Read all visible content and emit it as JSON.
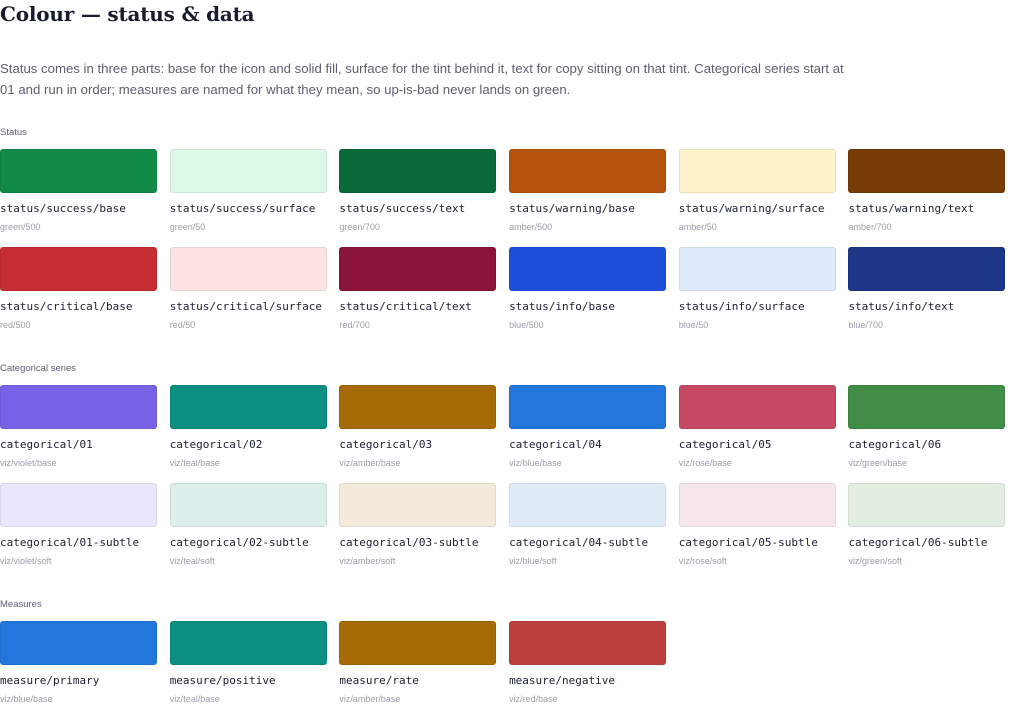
{
  "title": "Colour — status & data",
  "intro": "Status comes in three parts: base for the icon and solid fill, surface for the tint behind it, text for copy sitting on that tint. Categorical series start at 01 and run in order; measures are named for what they mean, so up-is-bad never lands on green.",
  "sections": [
    {
      "label": "Status",
      "rows": [
        [
          {
            "name": "status/success/base",
            "sub": "green/500",
            "color": "#128a48"
          },
          {
            "name": "status/success/surface",
            "sub": "green/50",
            "color": "#dcf8e6"
          },
          {
            "name": "status/success/text",
            "sub": "green/700",
            "color": "#0a6938"
          },
          {
            "name": "status/warning/base",
            "sub": "amber/500",
            "color": "#b5520d"
          },
          {
            "name": "status/warning/surface",
            "sub": "amber/50",
            "color": "#fdf2c9"
          },
          {
            "name": "status/warning/text",
            "sub": "amber/700",
            "color": "#763b06"
          }
        ],
        [
          {
            "name": "status/critical/base",
            "sub": "red/500",
            "color": "#c62e33"
          },
          {
            "name": "status/critical/surface",
            "sub": "red/50",
            "color": "#fde2e2"
          },
          {
            "name": "status/critical/text",
            "sub": "red/700",
            "color": "#8b1337"
          },
          {
            "name": "status/info/base",
            "sub": "blue/500",
            "color": "#1d4fdb"
          },
          {
            "name": "status/info/surface",
            "sub": "blue/50",
            "color": "#dde9fd"
          },
          {
            "name": "status/info/text",
            "sub": "blue/700",
            "color": "#1d3687"
          }
        ]
      ]
    },
    {
      "label": "Categorical series",
      "rows": [
        [
          {
            "name": "categorical/01",
            "sub": "viz/violet/base",
            "color": "#7662e6"
          },
          {
            "name": "categorical/02",
            "sub": "viz/teal/base",
            "color": "#0b8f80"
          },
          {
            "name": "categorical/03",
            "sub": "viz/amber/base",
            "color": "#a66a07"
          },
          {
            "name": "categorical/04",
            "sub": "viz/blue/base",
            "color": "#2377dc"
          },
          {
            "name": "categorical/05",
            "sub": "viz/rose/base",
            "color": "#c64963"
          },
          {
            "name": "categorical/06",
            "sub": "viz/green/base",
            "color": "#418c47"
          }
        ],
        [
          {
            "name": "categorical/01-subtle",
            "sub": "viz/violet/soft",
            "color": "#e9e7fb"
          },
          {
            "name": "categorical/02-subtle",
            "sub": "viz/teal/soft",
            "color": "#dcefea"
          },
          {
            "name": "categorical/03-subtle",
            "sub": "viz/amber/soft",
            "color": "#f3eadb"
          },
          {
            "name": "categorical/04-subtle",
            "sub": "viz/blue/soft",
            "color": "#e0ebf8"
          },
          {
            "name": "categorical/05-subtle",
            "sub": "viz/rose/soft",
            "color": "#f6e7ea"
          },
          {
            "name": "categorical/06-subtle",
            "sub": "viz/green/soft",
            "color": "#e3eee3"
          }
        ]
      ]
    },
    {
      "label": "Measures",
      "rows": [
        [
          {
            "name": "measure/primary",
            "sub": "viz/blue/base",
            "color": "#2377dc"
          },
          {
            "name": "measure/positive",
            "sub": "viz/teal/base",
            "color": "#0b8f80"
          },
          {
            "name": "measure/rate",
            "sub": "viz/amber/base",
            "color": "#a66a07"
          },
          {
            "name": "measure/negative",
            "sub": "viz/red/base",
            "color": "#bc3f3e"
          }
        ]
      ]
    }
  ]
}
